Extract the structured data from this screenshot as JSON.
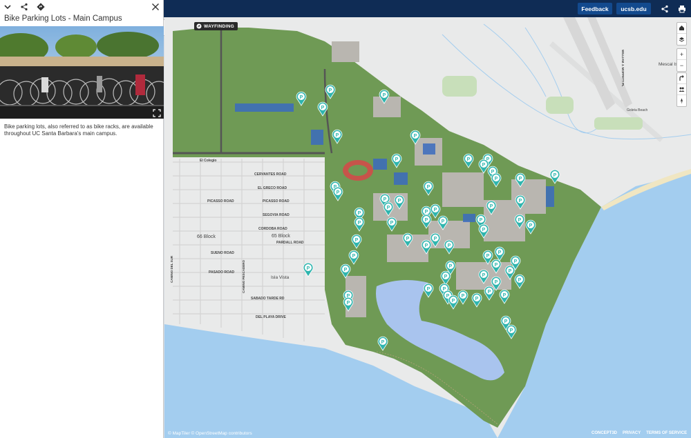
{
  "panel": {
    "title": "Bike Parking Lots - Main Campus",
    "description": "Bike parking lots, also referred to as bike racks, are available throughout UC Santa Barbara's main campus."
  },
  "header": {
    "feedback_label": "Feedback",
    "ucsb_label": "ucsb.edu"
  },
  "map": {
    "wayfinding_label": "WAYFINDING",
    "attribution": "© MapTiler © OpenStreetMap contributors",
    "brand": "CONCEPT3D",
    "privacy_label": "PRIVACY",
    "terms_label": "TERMS OF SERVICE",
    "labels": {
      "el_colegio": "El Colegio",
      "cervantes": "CERVANTES ROAD",
      "el_greco": "EL GRECO ROAD",
      "picasso1": "PICASSO ROAD",
      "picasso2": "PICASSO ROAD",
      "segovia": "SEGOVIA ROAD",
      "cordoba": "CORDOBA ROAD",
      "block66a": "66 Block",
      "block65": "65 Block",
      "pardall": "PARDALL ROAD",
      "sueno": "SUENO ROAD",
      "pasado": "PASADO ROAD",
      "sabado": "SABADO TARDE RD",
      "del_playa": "DEL PLAYA DRIVE",
      "camino_sur": "CAMINO DEL SUR",
      "camino_pescadero": "CAMINO PESCADERO",
      "isla_vista": "Isla Vista",
      "mescal": "Mescal Island",
      "goleta_beach": "Goleta Beach",
      "mofett": "WILLIAM J. MOFFETT PL"
    }
  },
  "colors": {
    "topbar": "#0f2c55",
    "button": "#134a8e",
    "campus_green": "#6f9a55",
    "ocean": "#a3cdef",
    "lagoon": "#a9c4ee",
    "marker": "#2fb5ae"
  },
  "icons": [
    "chevron-down-icon",
    "share-icon",
    "directions-icon",
    "close-icon",
    "expand-icon",
    "print-icon",
    "home-icon",
    "layers-icon",
    "plus-icon",
    "minus-icon",
    "rotate-icon",
    "people-icon",
    "compass-icon",
    "bike-parking-marker-icon"
  ]
}
